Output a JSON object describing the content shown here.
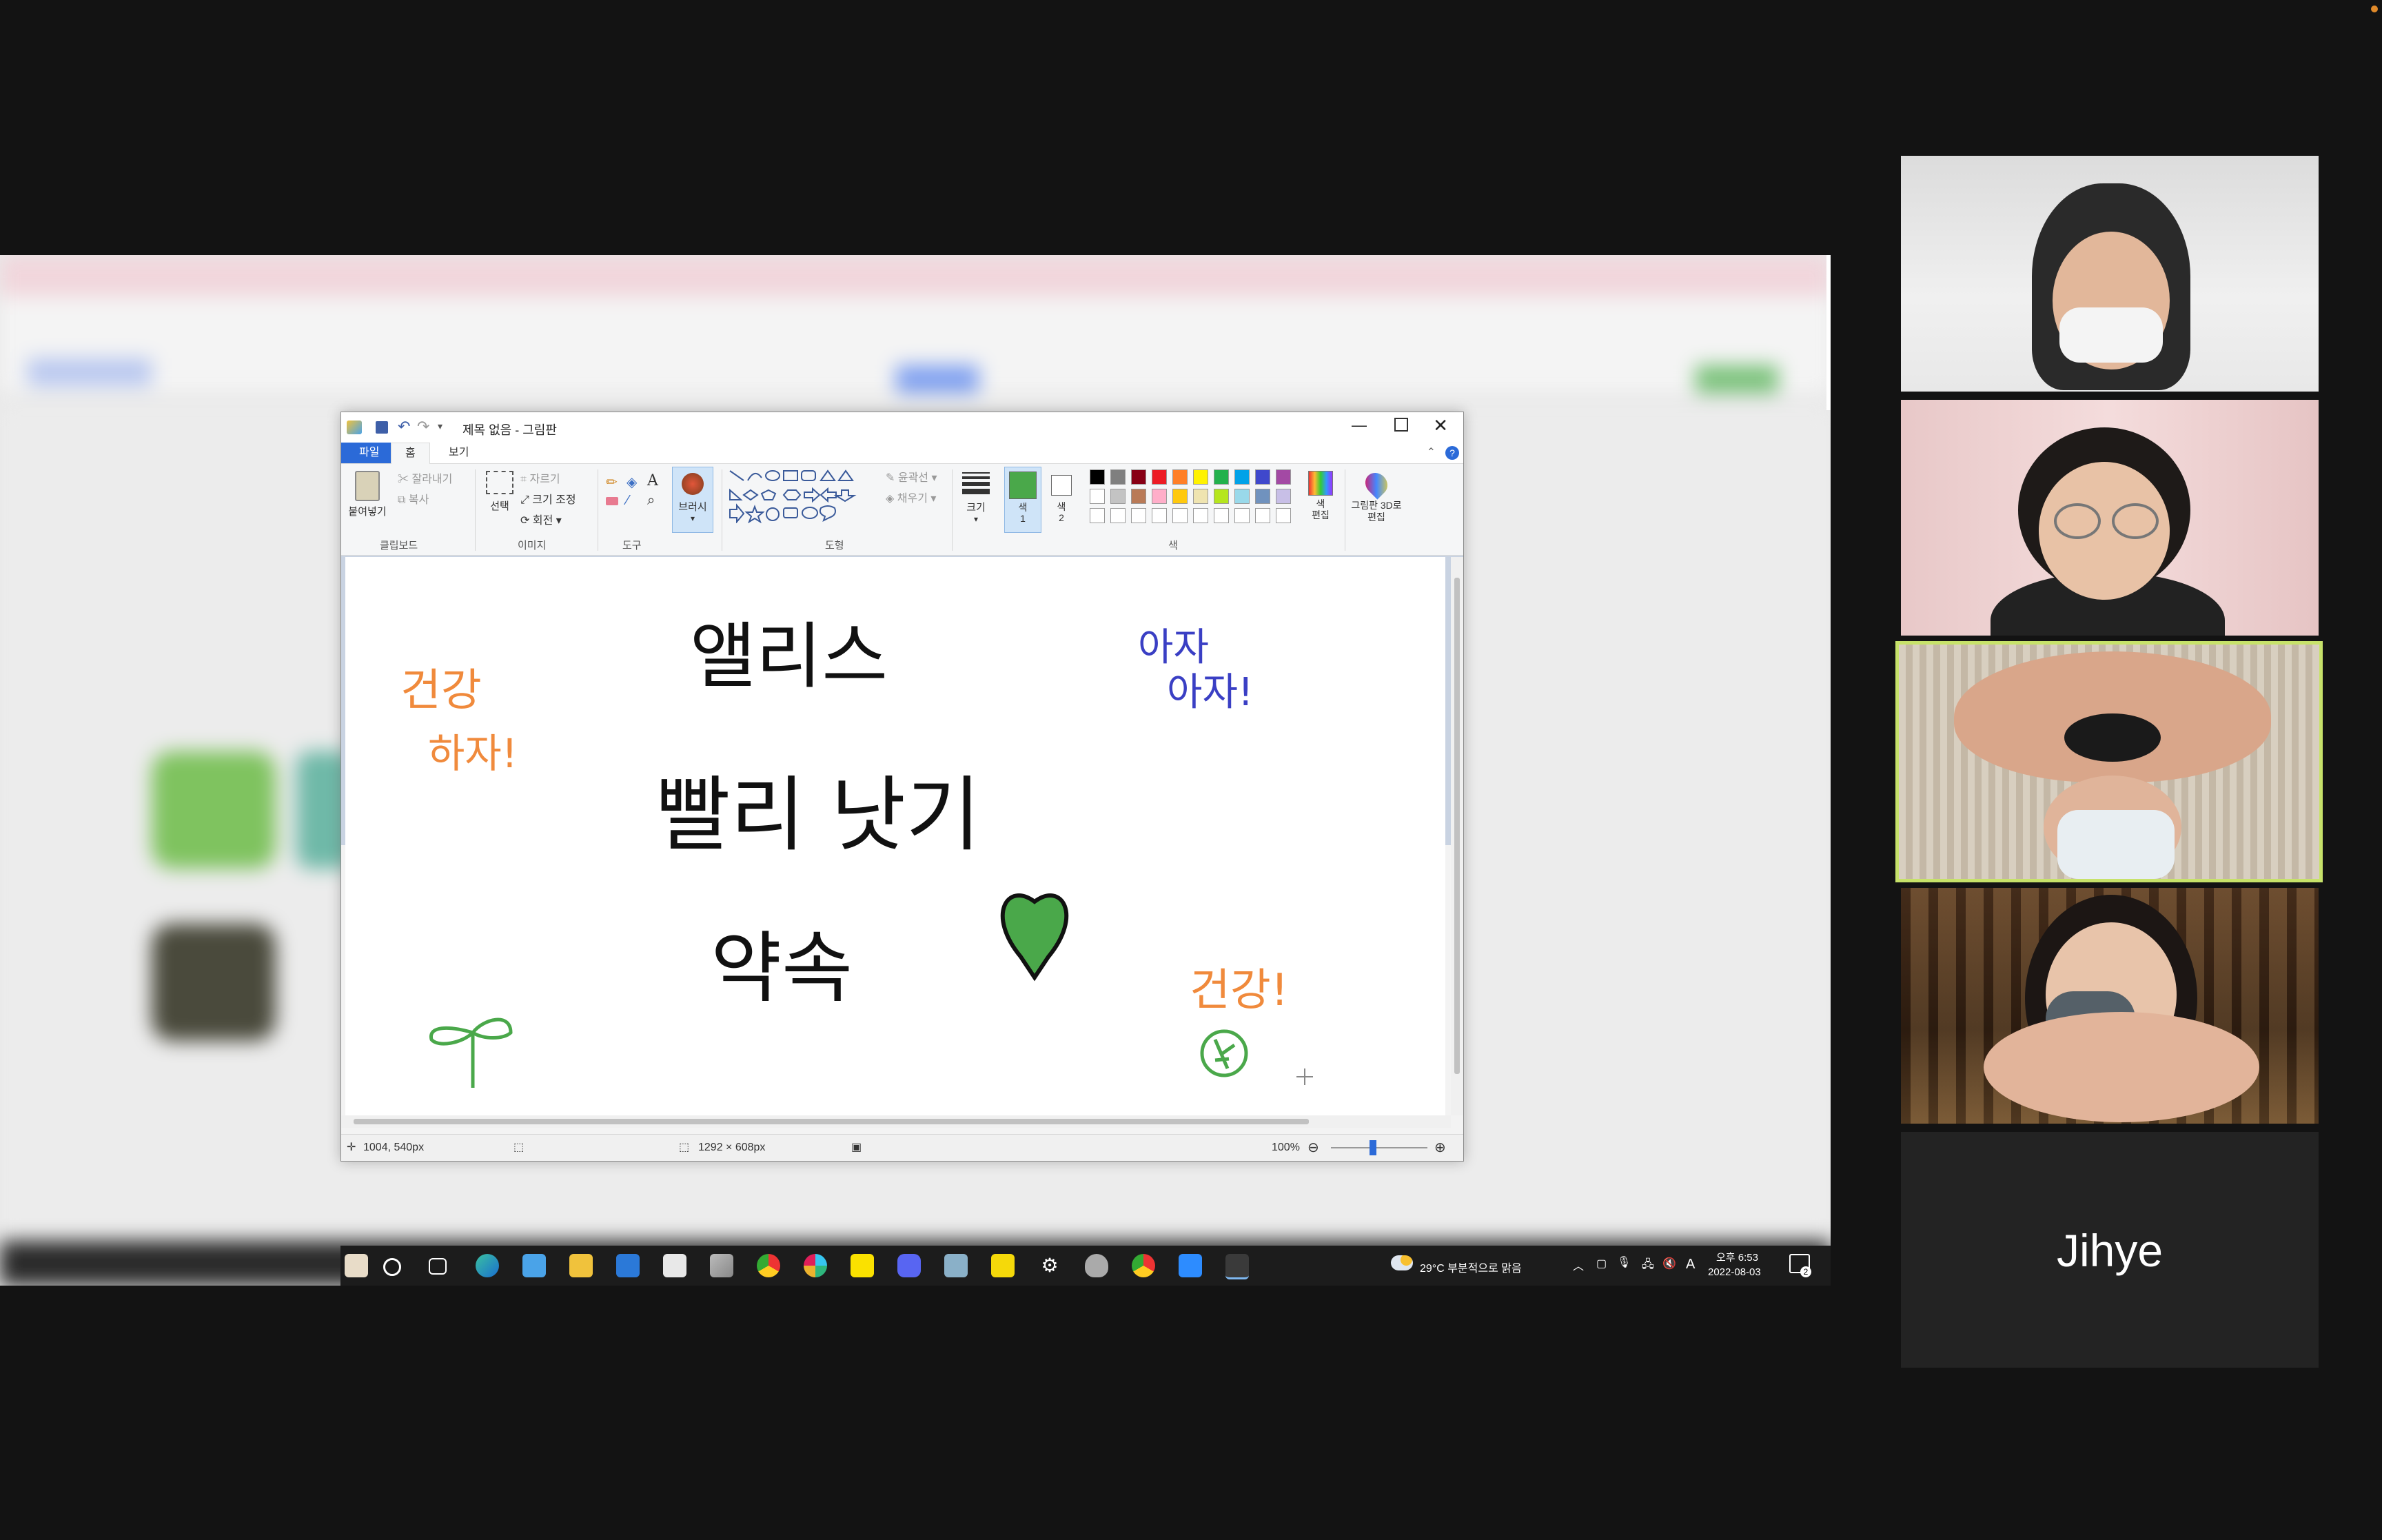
{
  "paint": {
    "title": "제목 없음 - 그림판",
    "tabs": [
      "파일",
      "홈",
      "보기"
    ],
    "clipboard": {
      "paste": "붙여넣기",
      "cut": "잘라내기",
      "copy": "복사",
      "group": "클립보드"
    },
    "image": {
      "select": "선택",
      "crop": "자르기",
      "resize": "크기 조정",
      "rotate": "회전",
      "group": "이미지"
    },
    "tools": {
      "group": "도구",
      "brush": "브러시"
    },
    "shapes": {
      "outline": "윤곽선",
      "fill": "채우기",
      "group": "도형"
    },
    "size": "크기",
    "color1": "색 1",
    "color2": "색 2",
    "colors_group": "색",
    "edit_colors": "색 편집",
    "paint3d": "그림판 3D로 편집",
    "palette": [
      "#000000",
      "#7f7f7f",
      "#880015",
      "#ed1c24",
      "#ff7f27",
      "#fff200",
      "#22b14c",
      "#00a2e8",
      "#3f48cc",
      "#a349a4",
      "#ffffff",
      "#c3c3c3",
      "#b97a57",
      "#ffaec9",
      "#ffc90e",
      "#efe4b0",
      "#b5e61d",
      "#99d9ea",
      "#7092be",
      "#c8bfe7"
    ],
    "status": {
      "cursor": "1004, 540px",
      "size": "1292 × 608px",
      "zoom": "100%"
    },
    "drawing": {
      "line1": "앨리스",
      "line2": "빨리 낫기",
      "line3": "약속",
      "left_note_1": "건강",
      "left_note_2": "하자!",
      "right_note_1": "아자",
      "right_note_2": "아자!",
      "bottom_note": "건강!"
    }
  },
  "taskbar": {
    "weather": "29°C  부분적으로 맑음",
    "time": "오후 6:53",
    "date": "2022-08-03",
    "lang": "A",
    "notifications": "2"
  },
  "participants": [
    {
      "name": ""
    },
    {
      "name": ""
    },
    {
      "name": ""
    },
    {
      "name": ""
    },
    {
      "name": "Jihye"
    }
  ],
  "colors": {
    "active_speaker": "#c7e26a",
    "green": "#4aa84a",
    "orange": "#f08a3c",
    "blue": "#3a3fc4"
  }
}
